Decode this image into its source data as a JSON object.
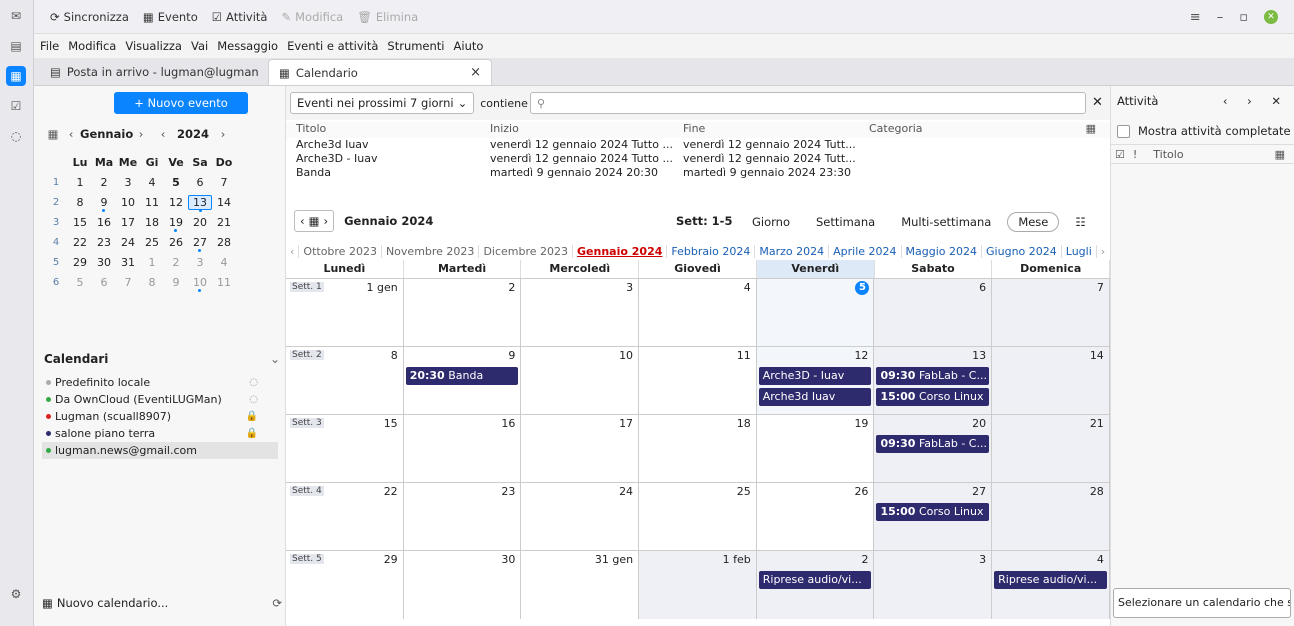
{
  "toolbar": {
    "sync": "Sincronizza",
    "event": "Evento",
    "activity": "Attività",
    "edit": "Modifica",
    "delete": "Elimina"
  },
  "menu": [
    "File",
    "Modifica",
    "Visualizza",
    "Vai",
    "Messaggio",
    "Eventi e attività",
    "Strumenti",
    "Aiuto"
  ],
  "tabs": {
    "mail": "Posta in arrivo - lugman@lugman.c",
    "calendar": "Calendario",
    "close": "×"
  },
  "left": {
    "new_event": "+ Nuovo evento",
    "month": "Gennaio",
    "year": "2024",
    "weekday_headers": [
      "Lu",
      "Ma",
      "Me",
      "Gi",
      "Ve",
      "Sa",
      "Do"
    ],
    "mini_weeks": [
      {
        "wk": "1",
        "days": [
          "1",
          "2",
          "3",
          "4",
          "5",
          "6",
          "7"
        ]
      },
      {
        "wk": "2",
        "days": [
          "8",
          "9",
          "10",
          "11",
          "12",
          "13",
          "14"
        ]
      },
      {
        "wk": "3",
        "days": [
          "15",
          "16",
          "17",
          "18",
          "19",
          "20",
          "21"
        ]
      },
      {
        "wk": "4",
        "days": [
          "22",
          "23",
          "24",
          "25",
          "26",
          "27",
          "28"
        ]
      },
      {
        "wk": "5",
        "days": [
          "29",
          "30",
          "31",
          "1",
          "2",
          "3",
          "4"
        ]
      },
      {
        "wk": "6",
        "days": [
          "5",
          "6",
          "7",
          "8",
          "9",
          "10",
          "11"
        ]
      }
    ],
    "calendars_title": "Calendari",
    "calendars": [
      {
        "name": "Predefinito locale",
        "color": "#aaaaaa"
      },
      {
        "name": "Da OwnCloud (EventiLUGMan)",
        "color": "#33aa44"
      },
      {
        "name": "Lugman (scuall8907)",
        "color": "#dd2222"
      },
      {
        "name": "salone piano terra",
        "color": "#2e2a6e"
      },
      {
        "name": "lugman.news@gmail.com",
        "color": "#33aa44"
      }
    ],
    "new_calendar": "Nuovo calendario..."
  },
  "filter": {
    "range": "Eventi nei prossimi 7 giorni",
    "contains": "contiene"
  },
  "event_list": {
    "headers": [
      "Titolo",
      "Inizio",
      "Fine",
      "Categoria"
    ],
    "rows": [
      [
        "Arche3d Iuav",
        "venerdì 12 gennaio 2024 Tutto ...",
        "venerdì 12 gennaio 2024 Tutt..."
      ],
      [
        "Arche3D - Iuav",
        "venerdì 12 gennaio 2024 Tutto ...",
        "venerdì 12 gennaio 2024 Tutt..."
      ],
      [
        "Banda",
        "martedì 9 gennaio 2024 20:30",
        "martedì 9 gennaio 2024 23:30"
      ]
    ]
  },
  "calnav": {
    "title": "Gennaio 2024",
    "weeks": "Sett: 1-5",
    "views": [
      "Giorno",
      "Settimana",
      "Multi-settimana",
      "Mese"
    ]
  },
  "months_strip": {
    "prev": [
      "Ottobre 2023",
      "Novembre 2023",
      "Dicembre 2023"
    ],
    "current": "Gennaio 2024",
    "next": [
      "Febbraio 2024",
      "Marzo 2024",
      "Aprile 2024",
      "Maggio 2024",
      "Giugno 2024",
      "Lugli"
    ]
  },
  "day_headers": [
    "Lunedì",
    "Martedì",
    "Mercoledì",
    "Giovedì",
    "Venerdì",
    "Sabato",
    "Domenica"
  ],
  "month_grid": [
    {
      "wk": "Sett. 1",
      "days": [
        "1 gen",
        "2",
        "3",
        "4",
        "5",
        "6",
        "7"
      ]
    },
    {
      "wk": "Sett. 2",
      "days": [
        "8",
        "9",
        "10",
        "11",
        "12",
        "13",
        "14"
      ]
    },
    {
      "wk": "Sett. 3",
      "days": [
        "15",
        "16",
        "17",
        "18",
        "19",
        "20",
        "21"
      ]
    },
    {
      "wk": "Sett. 4",
      "days": [
        "22",
        "23",
        "24",
        "25",
        "26",
        "27",
        "28"
      ]
    },
    {
      "wk": "Sett. 5",
      "days": [
        "29",
        "30",
        "31 gen",
        "1 feb",
        "2",
        "3",
        "4"
      ]
    }
  ],
  "events": [
    {
      "week": 1,
      "day": 1,
      "slot": 0,
      "time": "20:30",
      "title": "Banda"
    },
    {
      "week": 1,
      "day": 4,
      "slot": 0,
      "time": "",
      "title": "Arche3D - Iuav"
    },
    {
      "week": 1,
      "day": 4,
      "slot": 1,
      "time": "",
      "title": "Arche3d Iuav"
    },
    {
      "week": 1,
      "day": 5,
      "slot": 0,
      "time": "09:30",
      "title": "FabLab - C..."
    },
    {
      "week": 1,
      "day": 5,
      "slot": 1,
      "time": "15:00",
      "title": "Corso Linux"
    },
    {
      "week": 2,
      "day": 5,
      "slot": 0,
      "time": "09:30",
      "title": "FabLab - C..."
    },
    {
      "week": 3,
      "day": 5,
      "slot": 0,
      "time": "15:00",
      "title": "Corso Linux"
    },
    {
      "week": 4,
      "day": 4,
      "slot": 0,
      "time": "",
      "title": "Riprese audio/vi..."
    },
    {
      "week": 4,
      "day": 6,
      "slot": 0,
      "time": "",
      "title": "Riprese audio/vi..."
    }
  ],
  "right": {
    "title": "Attività",
    "show_completed": "Mostra attività completate",
    "col_title": "Titolo",
    "hint": "Selezionare un calendario che s"
  }
}
